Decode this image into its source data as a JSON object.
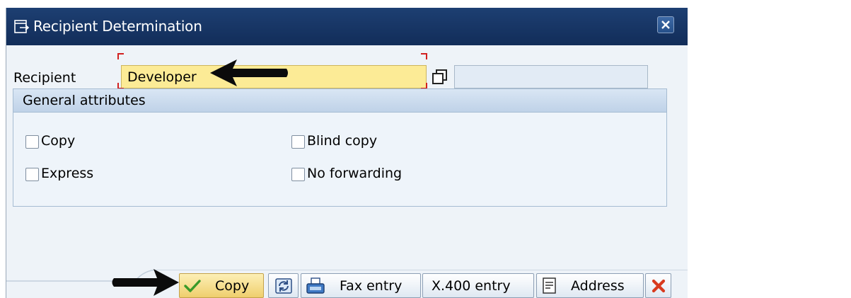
{
  "dialog": {
    "title": "Recipient Determination"
  },
  "recipient": {
    "label": "Recipient",
    "value": "Developer"
  },
  "general_attributes": {
    "title": "General attributes",
    "options": [
      {
        "label": "Copy",
        "checked": false
      },
      {
        "label": "Blind copy",
        "checked": false
      },
      {
        "label": "Express",
        "checked": false
      },
      {
        "label": "No forwarding",
        "checked": false
      }
    ]
  },
  "toolbar": {
    "copy_label": "Copy",
    "fax_label": "Fax entry",
    "x400_label": "X.400 entry",
    "address_label": "Address"
  },
  "colors": {
    "title_bar": "#1d3f72",
    "required_field": "#fceb96",
    "primary_button": "#efcf6d",
    "check_green": "#3a9a2a",
    "cancel_red": "#d83a1e"
  },
  "icons": [
    "window-icon",
    "close-icon",
    "value-help-icon",
    "check-icon",
    "refresh-icon",
    "fax-icon",
    "address-icon",
    "cancel-icon",
    "pointer-arrow"
  ]
}
